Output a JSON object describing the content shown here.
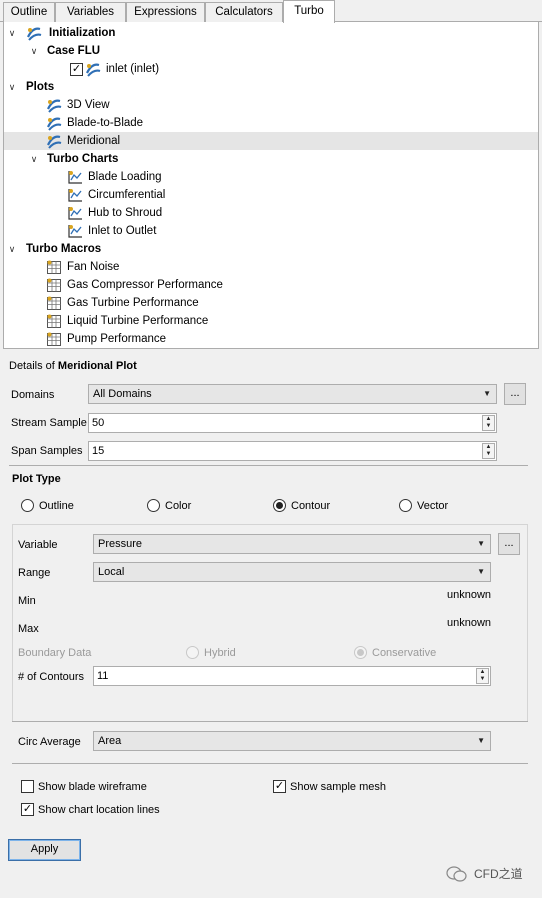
{
  "tabs": [
    "Outline",
    "Variables",
    "Expressions",
    "Calculators",
    "Turbo"
  ],
  "tree": {
    "initialization": "Initialization",
    "case_flu": "Case FLU",
    "inlet": "inlet (inlet)",
    "plots": "Plots",
    "plot_items": [
      "3D View",
      "Blade-to-Blade",
      "Meridional"
    ],
    "turbo_charts": "Turbo Charts",
    "chart_items": [
      "Blade Loading",
      "Circumferential",
      "Hub to Shroud",
      "Inlet to Outlet"
    ],
    "turbo_macros": "Turbo Macros",
    "macro_items": [
      "Fan Noise",
      "Gas Compressor Performance",
      "Gas Turbine Performance",
      "Liquid Turbine Performance",
      "Pump Performance"
    ]
  },
  "details": {
    "prefix": "Details of ",
    "title": "Meridional Plot",
    "domains_label": "Domains",
    "domains_value": "All Domains",
    "stream_label": "Stream Sample",
    "stream_value": "50",
    "span_label": "Span Samples",
    "span_value": "15",
    "dots": "..."
  },
  "plot_type": {
    "heading": "Plot Type",
    "options": [
      "Outline",
      "Color",
      "Contour",
      "Vector"
    ],
    "selected": "Contour",
    "variable_label": "Variable",
    "variable_value": "Pressure",
    "range_label": "Range",
    "range_value": "Local",
    "min_label": "Min",
    "min_value": "unknown",
    "max_label": "Max",
    "max_value": "unknown",
    "boundary_label": "Boundary Data",
    "hybrid": "Hybrid",
    "conservative": "Conservative",
    "contours_label": "# of Contours",
    "contours_value": "11"
  },
  "circ": {
    "label": "Circ Average",
    "value": "Area"
  },
  "checks": {
    "blade_wireframe": "Show blade wireframe",
    "sample_mesh": "Show sample mesh",
    "chart_lines": "Show chart location lines"
  },
  "apply_label": "Apply",
  "watermark": "CFD之道"
}
